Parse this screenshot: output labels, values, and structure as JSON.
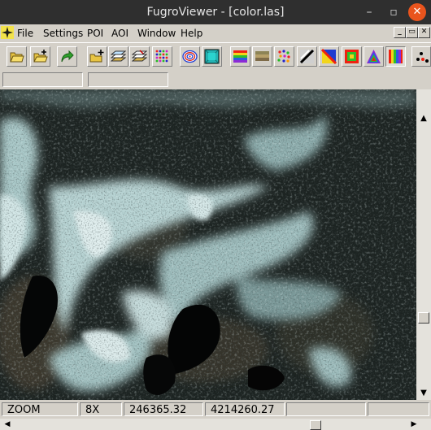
{
  "window": {
    "title": "FugroViewer - [color.las]",
    "minimize": "–",
    "maximize": "▫",
    "close": "✕"
  },
  "menu": {
    "items": [
      "File",
      "Settings",
      "POI",
      "AOI",
      "Window",
      "Help"
    ],
    "mdi_controls": [
      "_",
      "▭",
      "✕"
    ]
  },
  "toolbar": {
    "tools": [
      "open-folder-icon",
      "open-folder-add-icon",
      "redo-arrow-icon",
      "folder-plus-icon",
      "layers-add-icon",
      "layers-select-icon",
      "color-dots-grid-icon",
      "contour-rings-icon",
      "teal-square-icon",
      "rainbow-bands-icon",
      "brown-bands-icon",
      "color-dots-icon",
      "diagonal-line-icon",
      "gradient-triangle-icon",
      "nested-squares-icon",
      "rainbow-triangle-icon",
      "vertical-bars-icon",
      "dots-icon"
    ]
  },
  "status": {
    "mode": "ZOOM",
    "zoom": "8X",
    "x": "246365.32",
    "y": "4214260.27",
    "extra": ""
  },
  "scroll": {
    "vertical_position": 0.78,
    "horizontal_position": 0.78
  }
}
